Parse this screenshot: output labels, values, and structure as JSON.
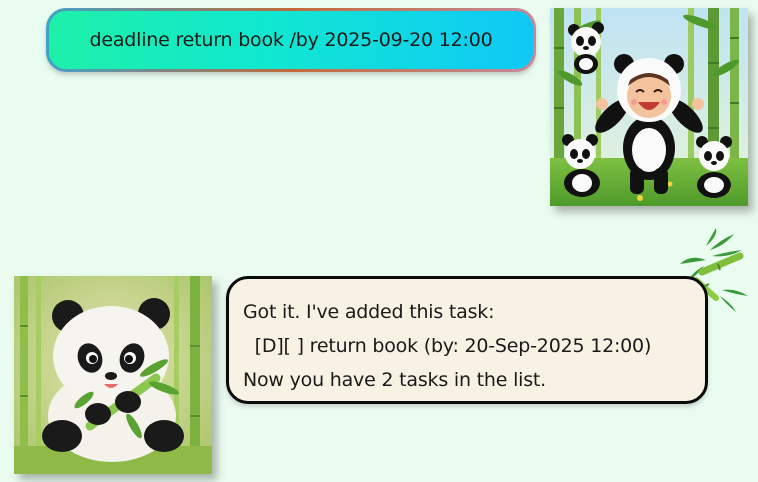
{
  "messages": [
    {
      "role": "user",
      "text": "deadline return book /by 2025-09-20 12:00",
      "avatar": "child-in-panda-costume-with-three-panda-cubs-in-bamboo-forest"
    },
    {
      "role": "bot",
      "lines": [
        "Got it. I've added this task:",
        "  [D][ ] return book (by: 20-Sep-2025 12:00)",
        "Now you have 2 tasks in the list."
      ],
      "avatar": "panda-cub-eating-bamboo",
      "decoration": "bamboo-leaves-icon"
    }
  ],
  "colors": {
    "background": "#eafcf0",
    "user_bubble_start": "#1ef0a8",
    "user_bubble_end": "#10c8f6",
    "bot_bubble": "#f8f2e4",
    "bot_border": "#0a0a0a"
  }
}
